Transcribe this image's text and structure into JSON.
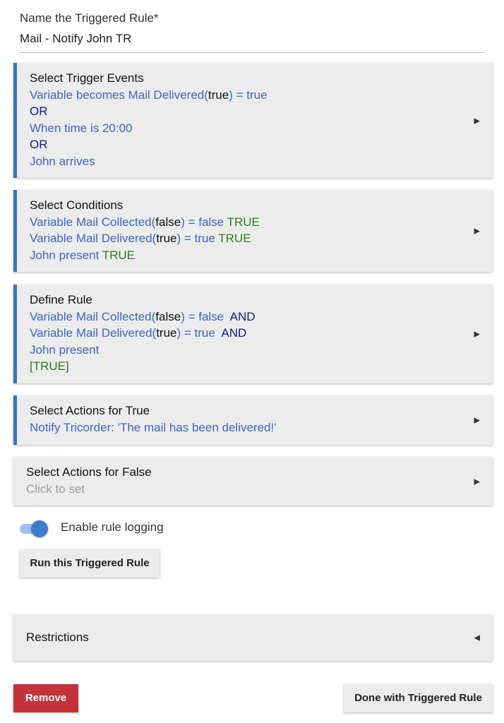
{
  "name_field": {
    "label": "Name the Triggered Rule*",
    "value": "Mail - Notify John TR"
  },
  "trigger_events": {
    "title": "Select Trigger Events",
    "trigger1_prefix": "Variable becomes Mail Delivered(",
    "trigger1_state": "true",
    "trigger1_suffix": ") = true",
    "or1": "OR",
    "trigger2": "When time is 20:00",
    "or2": "OR",
    "trigger3": "John arrives"
  },
  "conditions": {
    "title": "Select Conditions",
    "c1_prefix": "Variable Mail Collected(",
    "c1_state": "false",
    "c1_suffix": ") = false",
    "c1_result": "TRUE",
    "c2_prefix": "Variable Mail Delivered(",
    "c2_state": "true",
    "c2_suffix": ") = true",
    "c2_result": "TRUE",
    "c3_text": "John present",
    "c3_result": "TRUE"
  },
  "define_rule": {
    "title": "Define Rule",
    "r1_prefix": "Variable Mail Collected(",
    "r1_state": "false",
    "r1_suffix": ") = false",
    "r1_op": "AND",
    "r2_prefix": "Variable Mail Delivered(",
    "r2_state": "true",
    "r2_suffix": ") = true",
    "r2_op": "AND",
    "r3_text": "John present",
    "result": "[TRUE]"
  },
  "actions_true": {
    "title": "Select Actions for True",
    "action": "Notify Tricorder: 'The mail has been delivered!'"
  },
  "actions_false": {
    "title": "Select Actions for False",
    "placeholder": "Click to set"
  },
  "logging": {
    "label": "Enable rule logging",
    "enabled": true
  },
  "buttons": {
    "run": "Run this Triggered Rule",
    "remove": "Remove",
    "done": "Done with Triggered Rule"
  },
  "restrictions": {
    "title": "Restrictions"
  },
  "icons": {
    "expand": "caret-right-icon",
    "collapse": "caret-left-icon"
  },
  "colors": {
    "accent": "#3b73c3",
    "link_blue": "#3b65c6",
    "navy": "#0c1f80",
    "true_green": "#2e7d1f",
    "remove_red": "#c4333a",
    "panel_bg": "#ececec"
  }
}
